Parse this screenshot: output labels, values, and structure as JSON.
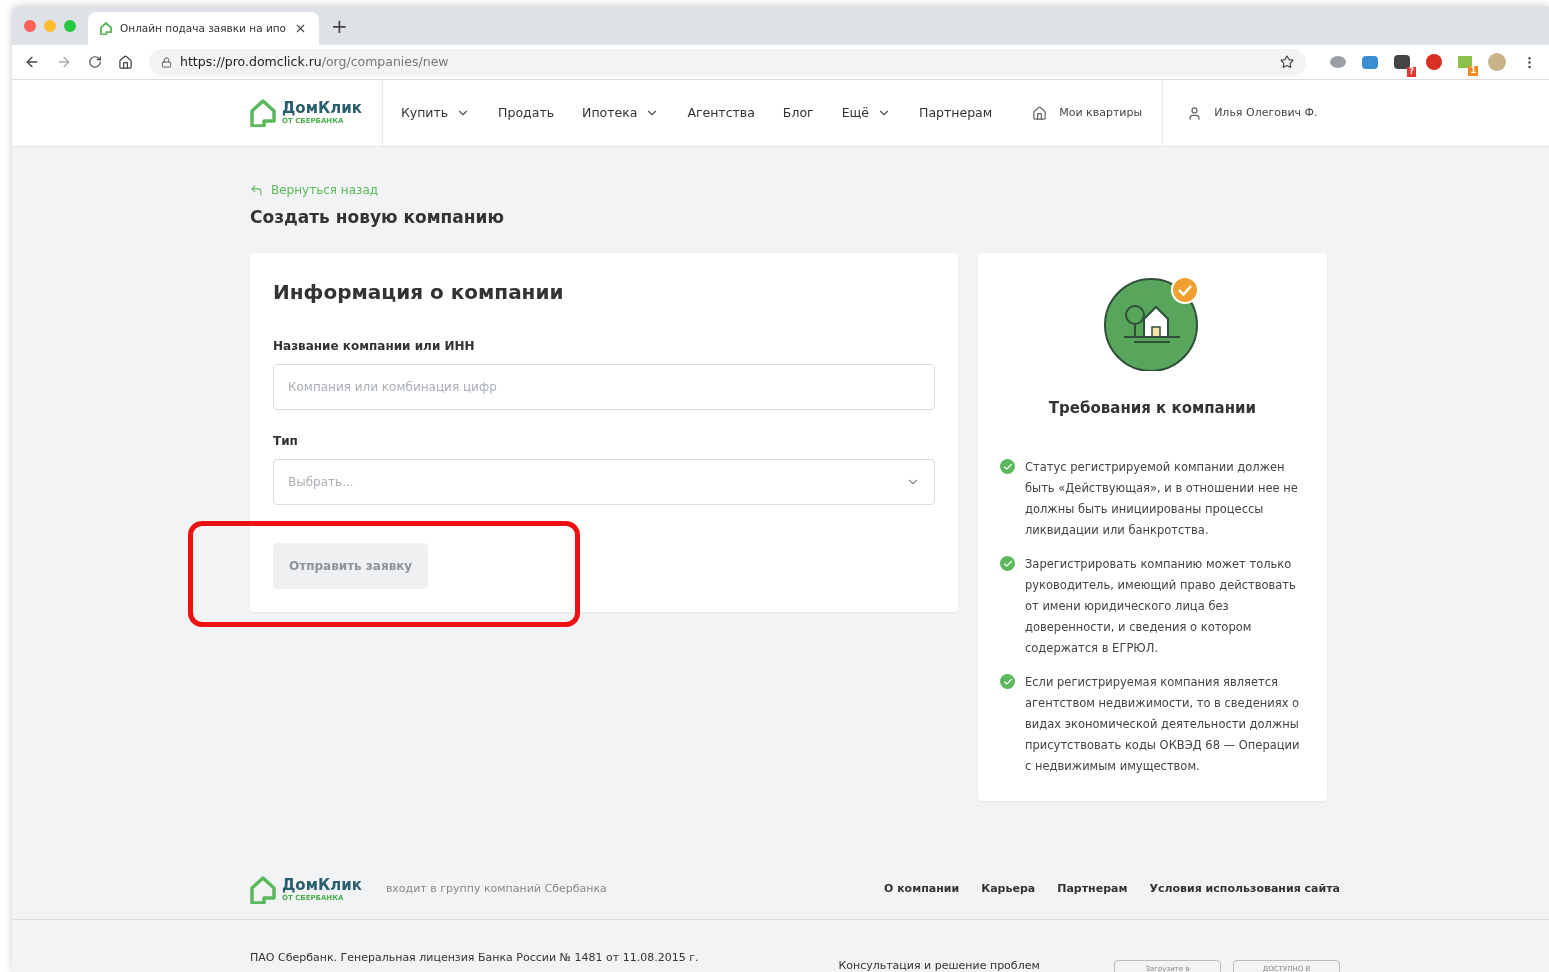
{
  "browser": {
    "tab_title": "Онлайн подача заявки на ипо",
    "new_tab": "+",
    "url_host": "https://pro.domclick.ru",
    "url_path": "/org/companies/new",
    "extensions": [
      {
        "kind": "disk"
      },
      {
        "kind": "screen"
      },
      {
        "kind": "tile",
        "badge": "?",
        "color": "#e53935"
      },
      {
        "kind": "round"
      },
      {
        "kind": "bars",
        "badge": "1",
        "color": "#f08a24"
      }
    ]
  },
  "header": {
    "logo": {
      "name": "ДомКлик",
      "sub": "ОТ СБЕРБАНКА"
    },
    "nav": [
      {
        "label": "Купить",
        "dropdown": true
      },
      {
        "label": "Продать",
        "dropdown": false
      },
      {
        "label": "Ипотека",
        "dropdown": true
      },
      {
        "label": "Агентства",
        "dropdown": false
      },
      {
        "label": "Блог",
        "dropdown": false
      },
      {
        "label": "Ещё",
        "dropdown": true
      },
      {
        "label": "Партнерам",
        "dropdown": false
      }
    ],
    "my_flats": "Мои квартиры",
    "user": "Илья Олегович Ф."
  },
  "back_link": "Вернуться назад",
  "page_title": "Создать новую компанию",
  "form": {
    "title": "Информация о компании",
    "fields": [
      {
        "kind": "text",
        "label": "Название компании или ИНН",
        "placeholder": "Компания или комбинация цифр"
      },
      {
        "kind": "select",
        "label": "Тип",
        "placeholder": "Выбрать..."
      }
    ],
    "submit": {
      "label": "Отправить заявку",
      "disabled": true,
      "highlighted": true
    }
  },
  "requirements": {
    "title": "Требования к компании",
    "items": [
      "Статус регистрируемой компании должен быть «Действующая», и в отношении нее не должны быть инициированы процессы ликвидации или банкротства.",
      "Зарегистрировать компанию может только руководитель, имеющий право действовать от имени юридического лица без доверенности, и сведения о котором содержатся в ЕГРЮЛ.",
      "Если регистрируемая компания является агентством недвижимости, то в сведениях о видах экономической деятельности должны присутствовать коды ОКВЭД 68 — Операции с недвижимым имуществом."
    ]
  },
  "footer": {
    "logo": {
      "name": "ДомКлик",
      "sub": "ОТ СБЕРБАНКА"
    },
    "tagline": "входит в группу компаний Сбербанка",
    "links": [
      "О компании",
      "Карьера",
      "Партнерам",
      "Условия использования сайта"
    ],
    "license": "ПАО Сбербанк. Генеральная лицензия Банка России № 1481 от 11.08.2015 г.",
    "support": "Консультация и решение проблем",
    "stores": [
      "Загрузите в",
      "ДОСТУПНО В"
    ]
  }
}
